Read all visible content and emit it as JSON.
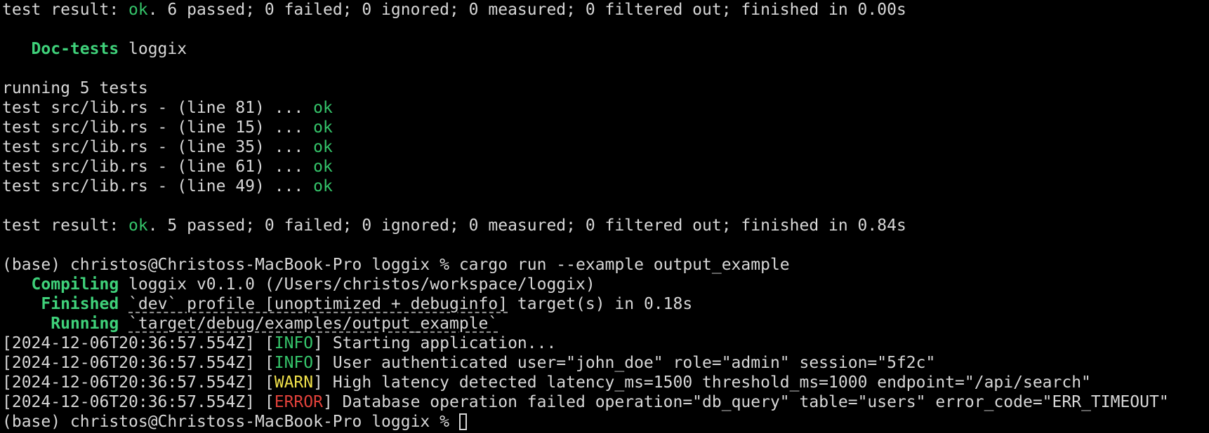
{
  "unit_tests": {
    "result_prefix": "test result: ",
    "ok": "ok",
    "result_rest": ". 6 passed; 0 failed; 0 ignored; 0 measured; 0 filtered out; finished in 0.00s"
  },
  "doc_tests": {
    "header_label": "Doc-tests",
    "crate": " loggix",
    "running": "running 5 tests",
    "tests": [
      {
        "name": "test src/lib.rs - (line 81) ... ",
        "status": "ok"
      },
      {
        "name": "test src/lib.rs - (line 15) ... ",
        "status": "ok"
      },
      {
        "name": "test src/lib.rs - (line 35) ... ",
        "status": "ok"
      },
      {
        "name": "test src/lib.rs - (line 61) ... ",
        "status": "ok"
      },
      {
        "name": "test src/lib.rs - (line 49) ... ",
        "status": "ok"
      }
    ],
    "result_prefix": "test result: ",
    "ok": "ok",
    "result_rest": ". 5 passed; 0 failed; 0 ignored; 0 measured; 0 filtered out; finished in 0.84s"
  },
  "prompt": "(base) christos@Christoss-MacBook-Pro loggix % ",
  "command": "cargo run --example output_example",
  "cargo": {
    "compiling_label": "Compiling",
    "compiling_text": " loggix v0.1.0 (/Users/christos/workspace/loggix)",
    "finished_label": "Finished",
    "finished_code": "`dev` profile [unoptimized + debuginfo]",
    "finished_text": " target(s) in 0.18s",
    "running_label": "Running",
    "running_code": "`target/debug/examples/output_example`"
  },
  "logs": [
    {
      "timestamp": "[2024-12-06T20:36:57.554Z] [",
      "level": "INFO",
      "message": "] Starting application..."
    },
    {
      "timestamp": "[2024-12-06T20:36:57.554Z] [",
      "level": "INFO",
      "message": "] User authenticated user=\"john_doe\" role=\"admin\" session=\"5f2c\""
    },
    {
      "timestamp": "[2024-12-06T20:36:57.554Z] [",
      "level": "WARN",
      "message": "] High latency detected latency_ms=1500 threshold_ms=1000 endpoint=\"/api/search\""
    },
    {
      "timestamp": "[2024-12-06T20:36:57.554Z] [",
      "level": "ERROR",
      "message": "] Database operation failed operation=\"db_query\" table=\"users\" error_code=\"ERR_TIMEOUT\""
    }
  ],
  "final_prompt": "(base) christos@Christoss-MacBook-Pro loggix % ",
  "colors": {
    "background": "#000000",
    "foreground": "#d7d7d7",
    "ok": "#35c46a",
    "info": "#35c46a",
    "warn": "#f0e04a",
    "error": "#e0413a"
  }
}
